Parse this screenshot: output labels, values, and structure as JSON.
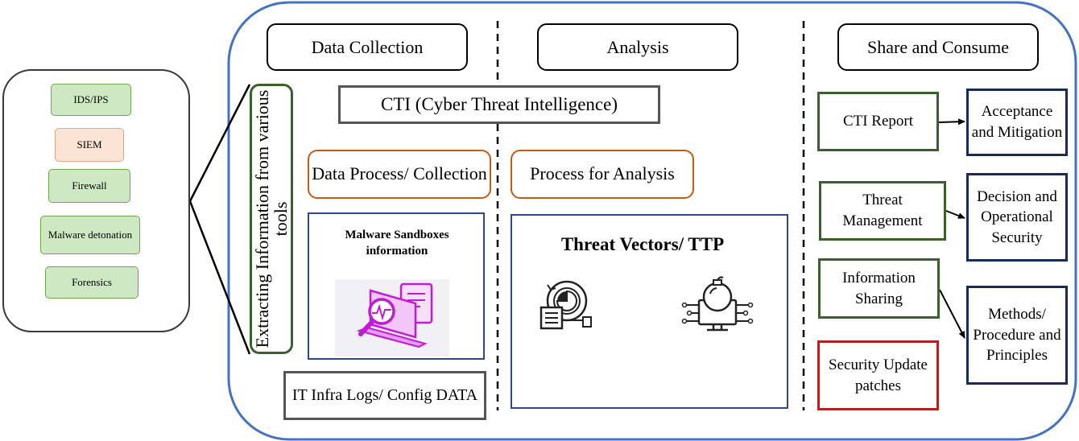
{
  "tools": [
    {
      "label": "IDS/IPS"
    },
    {
      "label": "SIEM"
    },
    {
      "label": "Firewall"
    },
    {
      "label": "Malware detonation"
    },
    {
      "label": "Forensics"
    }
  ],
  "extract_label": "Extracting Information from various tools",
  "headers": {
    "data_collection": "Data Collection",
    "analysis": "Analysis",
    "share": "Share and Consume"
  },
  "cti": "CTI (Cyber Threat Intelligence)",
  "data_process": "Data Process/ Collection",
  "process_analysis": "Process for Analysis",
  "malware_box": "Malware Sandboxes information",
  "threat_box": "Threat Vectors/ TTP",
  "it_infra": "IT Infra Logs/ Config DATA",
  "share": {
    "cti_report": "CTI Report",
    "threat_mgmt": "Threat Management",
    "info_sharing": "Information Sharing",
    "security_update": "Security Update patches",
    "acceptance": "Acceptance and Mitigation",
    "decision": "Decision and Operational Security",
    "methods": "Methods/ Procedure and Principles"
  },
  "colors": {
    "frame_blue": "#4472c4",
    "green_border": "#38612c",
    "navy_border": "#172c5a",
    "orange_border": "#c55a11",
    "red_border": "#ff0000",
    "tool_green": "#cfe8c4",
    "tool_peach": "#fbe3d6",
    "icon_purple": "#c21bd6"
  },
  "icons": [
    "laptop-analysis-icon",
    "target-report-icon",
    "bomb-computer-icon"
  ]
}
